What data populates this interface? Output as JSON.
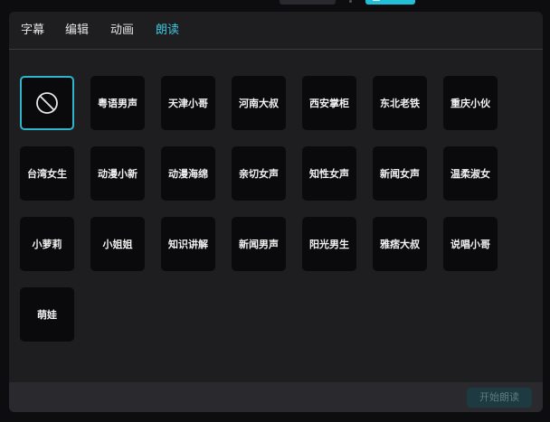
{
  "tabs": [
    {
      "label": "字幕",
      "active": false
    },
    {
      "label": "编辑",
      "active": false
    },
    {
      "label": "动画",
      "active": false
    },
    {
      "label": "朗读",
      "active": true
    }
  ],
  "voices": {
    "none": {
      "icon": "no-symbol-icon",
      "selected": true
    },
    "row1": [
      "粤语男声",
      "天津小哥",
      "河南大叔",
      "西安掌柜",
      "东北老铁",
      "重庆小伙"
    ],
    "row2": [
      "台湾女生",
      "动漫小新",
      "动漫海绵",
      "亲切女声",
      "知性女声",
      "新闻女声",
      "温柔淑女"
    ],
    "row3": [
      "小萝莉",
      "小姐姐",
      "知识讲解",
      "新闻男声",
      "阳光男生",
      "雅痞大叔",
      "说唱小哥"
    ],
    "row4": [
      "萌娃"
    ]
  },
  "footer": {
    "start_label": "开始朗读"
  },
  "colors": {
    "accent": "#3ec8e0",
    "panel_bg": "#1e1e21",
    "tile_bg": "#0a0a0c",
    "selected_border": "#2fb6cd"
  }
}
